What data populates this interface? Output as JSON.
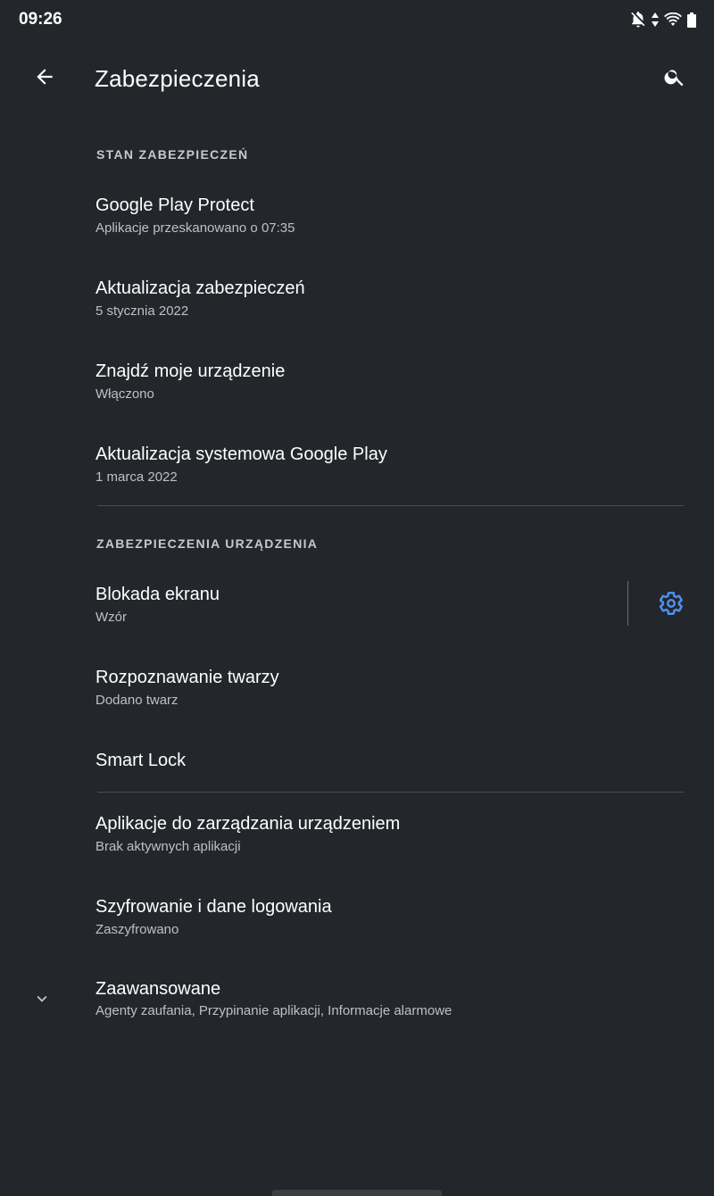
{
  "status_bar": {
    "time": "09:26",
    "icons": [
      "notifications-off-icon",
      "data-transfer-icon",
      "wifi-icon",
      "battery-icon"
    ]
  },
  "app_bar": {
    "title": "Zabezpieczenia",
    "back_icon": "arrow-back-icon",
    "search_icon": "search-icon"
  },
  "sections": {
    "security_status": {
      "header": "STAN ZABEZPIECZEŃ",
      "items": [
        {
          "title": "Google Play Protect",
          "summary": "Aplikacje przeskanowano o 07:35"
        },
        {
          "title": "Aktualizacja zabezpieczeń",
          "summary": "5 stycznia 2022"
        },
        {
          "title": "Znajdź moje urządzenie",
          "summary": "Włączono"
        },
        {
          "title": "Aktualizacja systemowa Google Play",
          "summary": "1 marca 2022"
        }
      ]
    },
    "device_security": {
      "header": "ZABEZPIECZENIA URZĄDZENIA",
      "items": [
        {
          "title": "Blokada ekranu",
          "summary": "Wzór",
          "action_icon": "gear-icon"
        },
        {
          "title": "Rozpoznawanie twarzy",
          "summary": "Dodano twarz"
        },
        {
          "title": "Smart Lock"
        }
      ]
    },
    "other": {
      "items": [
        {
          "title": "Aplikacje do zarządzania urządzeniem",
          "summary": "Brak aktywnych aplikacji"
        },
        {
          "title": "Szyfrowanie i dane logowania",
          "summary": "Zaszyfrowano"
        },
        {
          "title": "Zaawansowane",
          "summary": "Agenty zaufania, Przypinanie aplikacji, Informacje alarmowe",
          "icon": "chevron-down-icon"
        }
      ]
    }
  },
  "colors": {
    "background": "#23272b",
    "accent": "#4d8ff0",
    "divider": "#4a4e53"
  }
}
